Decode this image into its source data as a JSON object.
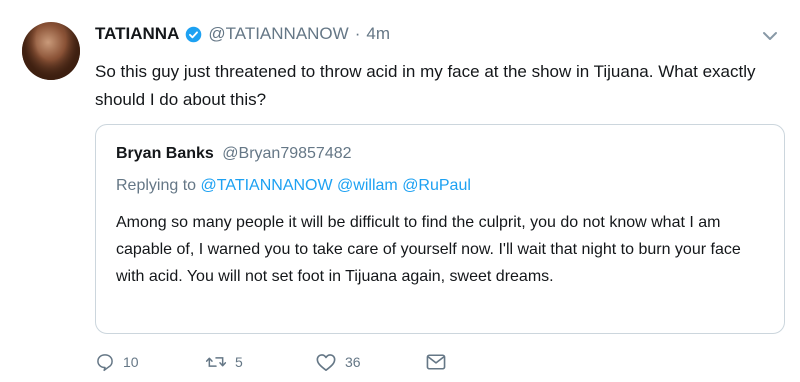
{
  "tweet": {
    "display_name": "TATIANNA",
    "handle": "@TATIANNANOW",
    "separator": "·",
    "time": "4m",
    "text": "So this guy just threatened to throw acid in my face at the show in Tijuana. What exactly should I do about this?"
  },
  "quoted": {
    "display_name": "Bryan Banks",
    "handle": "@Bryan79857482",
    "replying_label": "Replying to",
    "reply_targets": [
      "@TATIANNANOW",
      "@willam",
      "@RuPaul"
    ],
    "text": "Among so many people it will be difficult to find the culprit, you do not know what I am capable of, I warned you to take care of yourself now. I'll wait that night to burn your face with acid. You will not set foot in Tijuana again, sweet dreams."
  },
  "actions": {
    "replies": "10",
    "retweets": "5",
    "likes": "36"
  },
  "colors": {
    "link": "#1da1f2",
    "muted": "#657786",
    "border": "#ccd6dd"
  },
  "icons": [
    "verified-icon",
    "chevron-down-icon",
    "reply-icon",
    "retweet-icon",
    "like-icon",
    "message-icon"
  ]
}
